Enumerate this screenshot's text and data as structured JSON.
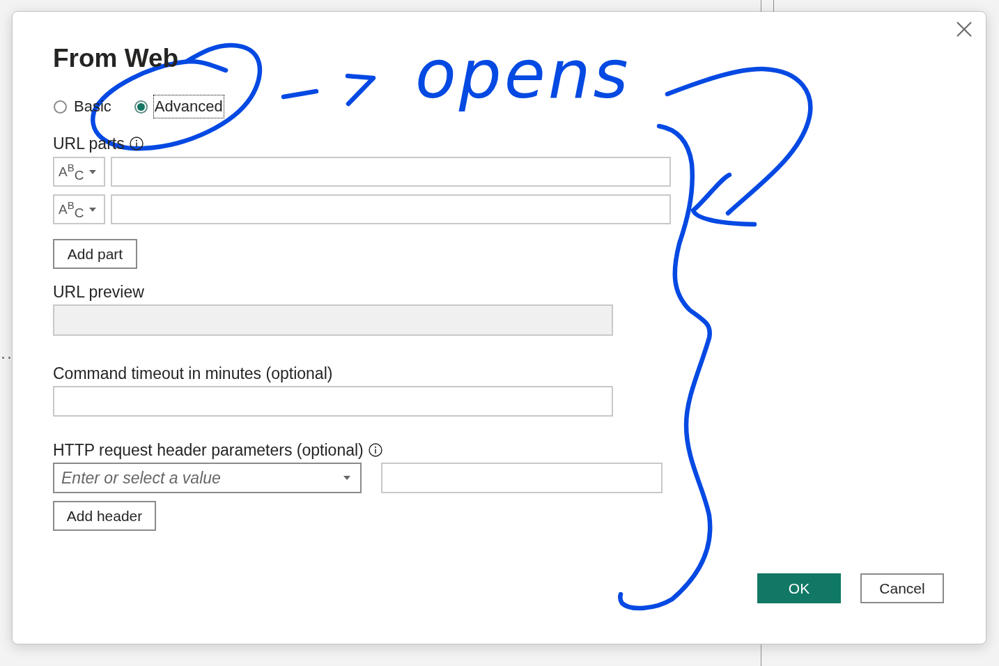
{
  "dialog": {
    "title": "From Web"
  },
  "modes": [
    {
      "label": "Basic",
      "selected": false,
      "focused": false
    },
    {
      "label": "Advanced",
      "selected": true,
      "focused": true
    }
  ],
  "url_parts": {
    "label": "URL parts",
    "rows": [
      {
        "type": "A$^{B}$$_{C}$"
      },
      {
        "type": "A$^{B}$$_{C}$"
      }
    ],
    "add_button": "Add part"
  },
  "url_preview": {
    "label": "URL preview",
    "disabled": true
  },
  "command_timeout": {
    "label": "Command timeout in minutes (optional)"
  },
  "http_headers": {
    "label": "HTTP request header parameters (optional)",
    "header_name": {
      "placeholder": "Enter or select a value"
    },
    "add_button": "Add header"
  },
  "footer_buttons": [
    {
      "label": "OK",
      "kind": "primary"
    },
    {
      "label": "Cancel",
      "kind": "secondary"
    }
  ],
  "annotation": {
    "note": "opens"
  }
}
